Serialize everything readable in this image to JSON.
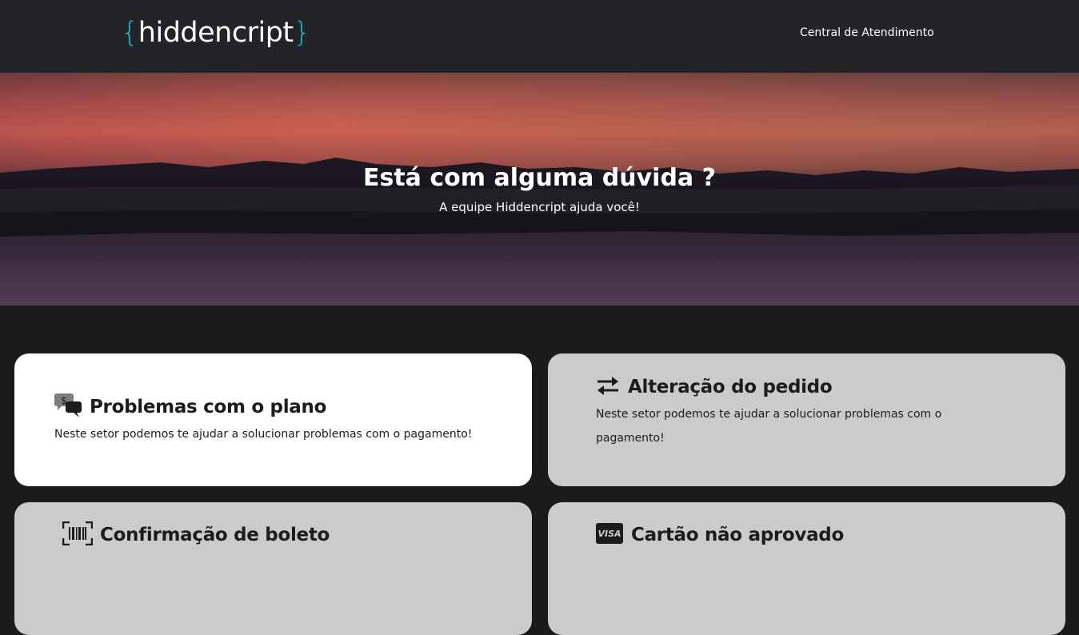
{
  "header": {
    "logo_open": "{",
    "logo_text": "hiddencript",
    "logo_close": "}",
    "nav_link": "Central de Atendimento"
  },
  "hero": {
    "title": "Está com alguma dúvida ?",
    "subtitle": "A equipe Hiddencript ajuda você!"
  },
  "cards": [
    {
      "icon": "money-chat-icon",
      "title": "Problemas com o plano",
      "text": "Neste setor podemos te ajudar a solucionar problemas com o pagamento!"
    },
    {
      "icon": "exchange-arrows-icon",
      "title": "Alteração do pedido",
      "text": "Neste setor podemos te ajudar a solucionar problemas com o pagamento!"
    },
    {
      "icon": "barcode-icon",
      "title": "Confirmação de boleto",
      "text": ""
    },
    {
      "icon": "visa-card-icon",
      "icon_text": "VISA",
      "title": "Cartão não aprovado",
      "text": ""
    }
  ],
  "colors": {
    "topbar": "#232428",
    "page_background": "#1b1b1c",
    "accent": "#1fb9c4",
    "card_active": "#ffffff",
    "card_default": "#cbcbcb"
  }
}
